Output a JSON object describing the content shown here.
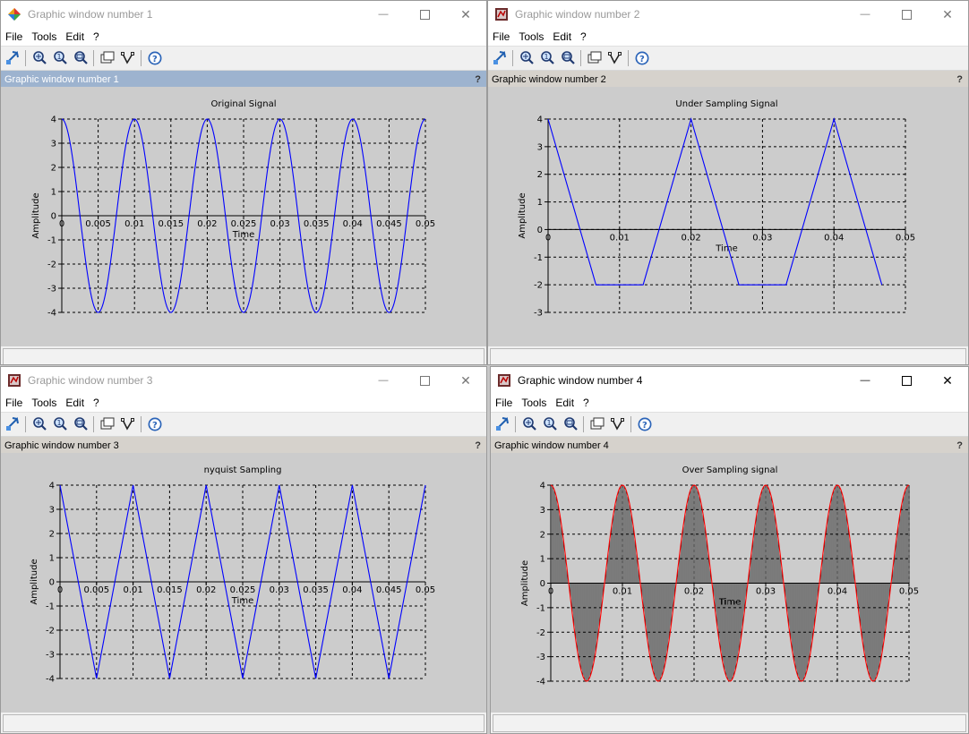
{
  "menus": [
    "File",
    "Tools",
    "Edit",
    "?"
  ],
  "windows": [
    {
      "title": "Graphic window number 1",
      "figure_label": "Graphic window number 1",
      "help": "?",
      "active": false,
      "selected": true,
      "icon": "scilab-diamond-icon",
      "chart": {
        "title": "Original Signal",
        "xlabel": "Time",
        "ylabel": "Amplitude",
        "xlim": [
          0,
          0.05
        ],
        "ylim": [
          -4,
          4
        ],
        "mode": "sine",
        "xticks": [
          "0",
          "0.005",
          "0.01",
          "0.015",
          "0.02",
          "0.025",
          "0.03",
          "0.035",
          "0.04",
          "0.045",
          "0.05"
        ],
        "xtick_values": [
          0,
          0.005,
          0.01,
          0.015,
          0.02,
          0.025,
          0.03,
          0.035,
          0.04,
          0.045,
          0.05
        ],
        "yticks": [
          4,
          3,
          2,
          1,
          0,
          -1,
          -2,
          -3,
          -4
        ],
        "ytick_labels": [
          "4",
          "3",
          "2",
          "1",
          "0",
          "-1",
          "-2",
          "-3",
          "-4"
        ]
      }
    },
    {
      "title": "Graphic window number 2",
      "figure_label": "Graphic window number 2",
      "help": "?",
      "active": false,
      "selected": false,
      "icon": "scilab-figure-icon",
      "chart": {
        "title": "Under Sampling Signal",
        "xlabel": "Time",
        "ylabel": "Amplitude",
        "xlim": [
          0,
          0.05
        ],
        "ylim": [
          -3,
          4
        ],
        "mode": "line",
        "xticks": [
          "0",
          "0.01",
          "0.02",
          "0.03",
          "0.04",
          "0.05"
        ],
        "xtick_values": [
          0,
          0.01,
          0.02,
          0.03,
          0.04,
          0.05
        ],
        "yticks": [
          4,
          3,
          2,
          1,
          0,
          -1,
          -2,
          -3
        ],
        "ytick_labels": [
          "4",
          "3",
          "2",
          "1",
          "0",
          "-1",
          "-2",
          "-3"
        ],
        "points": [
          [
            0,
            4
          ],
          [
            0.0067,
            -2
          ],
          [
            0.0133,
            -2
          ],
          [
            0.02,
            4
          ],
          [
            0.0267,
            -2
          ],
          [
            0.0333,
            -2
          ],
          [
            0.04,
            4
          ],
          [
            0.0467,
            -2
          ]
        ]
      }
    },
    {
      "title": "Graphic window number 3",
      "figure_label": "Graphic window number 3",
      "help": "?",
      "active": false,
      "selected": false,
      "icon": "scilab-figure-icon",
      "chart": {
        "title": "nyquist Sampling",
        "xlabel": "Time",
        "ylabel": "Amplitude",
        "xlim": [
          0,
          0.05
        ],
        "ylim": [
          -4,
          4
        ],
        "mode": "line",
        "xticks": [
          "0",
          "0.005",
          "0.01",
          "0.015",
          "0.02",
          "0.025",
          "0.03",
          "0.035",
          "0.04",
          "0.045",
          "0.05"
        ],
        "xtick_values": [
          0,
          0.005,
          0.01,
          0.015,
          0.02,
          0.025,
          0.03,
          0.035,
          0.04,
          0.045,
          0.05
        ],
        "yticks": [
          4,
          3,
          2,
          1,
          0,
          -1,
          -2,
          -3,
          -4
        ],
        "ytick_labels": [
          "4",
          "3",
          "2",
          "1",
          "0",
          "-1",
          "-2",
          "-3",
          "-4"
        ],
        "points": [
          [
            0,
            4
          ],
          [
            0.005,
            -4
          ],
          [
            0.01,
            4
          ],
          [
            0.015,
            -4
          ],
          [
            0.02,
            4
          ],
          [
            0.025,
            -4
          ],
          [
            0.03,
            4
          ],
          [
            0.035,
            -4
          ],
          [
            0.04,
            4
          ],
          [
            0.045,
            -4
          ],
          [
            0.05,
            4
          ]
        ]
      }
    },
    {
      "title": "Graphic window number 4",
      "figure_label": "Graphic window number 4",
      "help": "?",
      "active": true,
      "selected": false,
      "icon": "scilab-figure-icon",
      "chart": {
        "title": "Over Sampling signal",
        "xlabel": "Time",
        "ylabel": "Amplitude",
        "xlim": [
          0,
          0.05
        ],
        "ylim": [
          -4,
          4
        ],
        "mode": "stem",
        "xticks": [
          "0",
          "0.01",
          "0.02",
          "0.03",
          "0.04",
          "0.05"
        ],
        "xtick_values": [
          0,
          0.01,
          0.02,
          0.03,
          0.04,
          0.05
        ],
        "yticks": [
          4,
          3,
          2,
          1,
          0,
          -1,
          -2,
          -3,
          -4
        ],
        "ytick_labels": [
          "4",
          "3",
          "2",
          "1",
          "0",
          "-1",
          "-2",
          "-3",
          "-4"
        ]
      }
    }
  ],
  "chart_data": [
    {
      "type": "line",
      "title": "Original Signal",
      "xlabel": "Time",
      "ylabel": "Amplitude",
      "xlim": [
        0,
        0.05
      ],
      "ylim": [
        -4,
        4
      ],
      "series": [
        {
          "x": [
            0,
            0.005,
            0.01,
            0.015,
            0.02,
            0.025,
            0.03,
            0.035,
            0.04,
            0.045,
            0.05
          ],
          "y": [
            4,
            -4,
            4,
            -4,
            4,
            -4,
            4,
            -4,
            4,
            -4,
            4
          ]
        }
      ],
      "grid": true,
      "color": "#0000ff"
    },
    {
      "type": "line",
      "title": "Under Sampling Signal",
      "xlabel": "Time",
      "ylabel": "Amplitude",
      "xlim": [
        0,
        0.05
      ],
      "ylim": [
        -3,
        4
      ],
      "series": [
        {
          "x": [
            0,
            0.0067,
            0.0133,
            0.02,
            0.0267,
            0.0333,
            0.04,
            0.0467
          ],
          "y": [
            4,
            -2,
            -2,
            4,
            -2,
            -2,
            4,
            -2
          ]
        }
      ],
      "grid": true,
      "color": "#0000ff"
    },
    {
      "type": "line",
      "title": "nyquist Sampling",
      "xlabel": "Time",
      "ylabel": "Amplitude",
      "xlim": [
        0,
        0.05
      ],
      "ylim": [
        -4,
        4
      ],
      "series": [
        {
          "x": [
            0,
            0.005,
            0.01,
            0.015,
            0.02,
            0.025,
            0.03,
            0.035,
            0.04,
            0.045,
            0.05
          ],
          "y": [
            4,
            -4,
            4,
            -4,
            4,
            -4,
            4,
            -4,
            4,
            -4,
            4
          ]
        }
      ],
      "grid": true,
      "color": "#0000ff"
    },
    {
      "type": "line",
      "title": "Over Sampling signal",
      "xlabel": "Time",
      "ylabel": "Amplitude",
      "xlim": [
        0,
        0.05
      ],
      "ylim": [
        -4,
        4
      ],
      "series": [
        {
          "x": [
            0,
            0.005,
            0.01,
            0.015,
            0.02,
            0.025,
            0.03,
            0.035,
            0.04,
            0.045,
            0.05
          ],
          "y": [
            4,
            -4,
            4,
            -4,
            4,
            -4,
            4,
            -4,
            4,
            -4,
            4
          ]
        }
      ],
      "stems": true,
      "grid": true,
      "color": "#ff0000"
    }
  ]
}
